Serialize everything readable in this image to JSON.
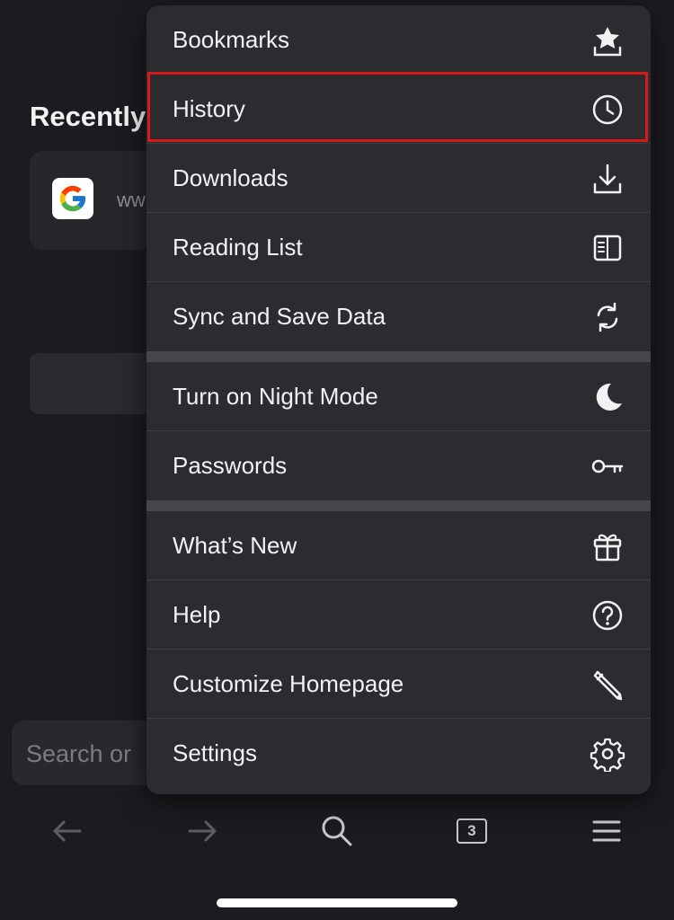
{
  "background": {
    "heading": "Recently",
    "recent_site_text": "ww",
    "search_placeholder": "Search or"
  },
  "menu": {
    "items": [
      {
        "label": "Bookmarks",
        "icon": "bookmark-star-icon"
      },
      {
        "label": "History",
        "icon": "clock-icon",
        "highlighted": true
      },
      {
        "label": "Downloads",
        "icon": "download-icon"
      },
      {
        "label": "Reading List",
        "icon": "reading-list-icon"
      },
      {
        "label": "Sync and Save Data",
        "icon": "sync-icon"
      },
      {
        "label": "Turn on Night Mode",
        "icon": "moon-icon"
      },
      {
        "label": "Passwords",
        "icon": "key-icon"
      },
      {
        "label": "What’s New",
        "icon": "gift-icon"
      },
      {
        "label": "Help",
        "icon": "help-icon"
      },
      {
        "label": "Customize Homepage",
        "icon": "pencil-icon"
      },
      {
        "label": "Settings",
        "icon": "gear-icon"
      }
    ]
  },
  "toolbar": {
    "tab_count": "3"
  },
  "colors": {
    "highlight": "#d7191c",
    "menu_background": "#2b2b30",
    "page_background": "#1c1c20"
  }
}
